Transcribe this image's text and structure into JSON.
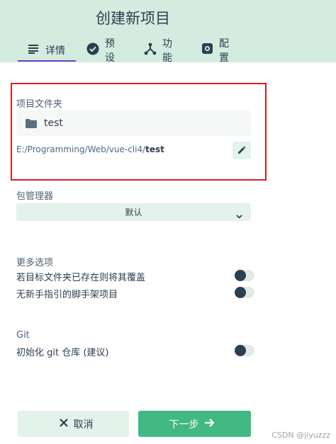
{
  "header": {
    "title": "创建新项目",
    "tabs": [
      {
        "label": "详情",
        "icon": "list-icon",
        "active": true
      },
      {
        "label": "预设",
        "icon": "check-circle-icon",
        "active": false
      },
      {
        "label": "功能",
        "icon": "fork-icon",
        "active": false
      },
      {
        "label": "配置",
        "icon": "gear-icon",
        "active": false
      }
    ]
  },
  "folder": {
    "label": "项目文件夹",
    "name": "test",
    "path_prefix": "E:/Programming/Web/vue-cli4/",
    "path_name": "test"
  },
  "package_manager": {
    "label": "包管理器",
    "value": "默认"
  },
  "more_options": {
    "label": "更多选项",
    "overwrite_label": "若目标文件夹已存在则将其覆盖",
    "overwrite_on": false,
    "no_guide_label": "无新手指引的脚手架项目",
    "no_guide_on": false
  },
  "git": {
    "label": "Git",
    "init_label": "初始化 git 仓库 (建议)",
    "init_on": false
  },
  "footer": {
    "cancel_label": "取消",
    "next_label": "下一步"
  },
  "watermark": "CSDN @jiyuzzz",
  "colors": {
    "header_bg": "#d4ecdf",
    "accent_green": "#42b983",
    "tab_underline": "#6f42c1",
    "highlight_red": "#dd1c24"
  }
}
